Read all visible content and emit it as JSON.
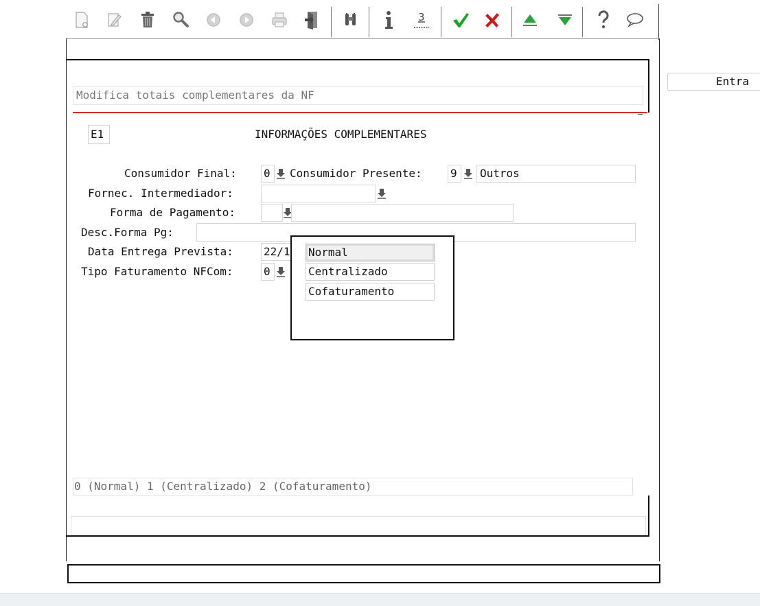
{
  "header": {
    "description": "Modifica totais complementares da NF",
    "screen_code": "E1",
    "screen_title": "INFORMAÇÕES COMPLEMENTARES"
  },
  "side": {
    "enter_label": "Entra"
  },
  "form": {
    "consumidor_final": {
      "label": "Consumidor Final:",
      "value": "0"
    },
    "consumidor_presente": {
      "label": "Consumidor Presente:",
      "value": "9",
      "description": "Outros"
    },
    "fornec_intermediador": {
      "label": "Fornec. Intermediador:",
      "value": ""
    },
    "forma_pagamento": {
      "label": "Forma de Pagamento:",
      "value": "",
      "description": ""
    },
    "desc_forma_pg": {
      "label": "Desc.Forma Pg:",
      "value": ""
    },
    "data_entrega": {
      "label": "Data Entrega Prevista:",
      "value": "22/1"
    },
    "tipo_faturamento": {
      "label": "Tipo Faturamento NFCom:",
      "value": "0"
    }
  },
  "popup": {
    "options": [
      "Normal",
      "Centralizado",
      "Cofaturamento"
    ],
    "selected": "Normal"
  },
  "hint": "0 (Normal)  1 (Centralizado)  2 (Cofaturamento)",
  "status_message": "",
  "colors": {
    "accent_red": "#d92b2b",
    "check_green": "#19a324",
    "cancel_red": "#d01c1c",
    "arrow_green": "#2aa33a"
  }
}
